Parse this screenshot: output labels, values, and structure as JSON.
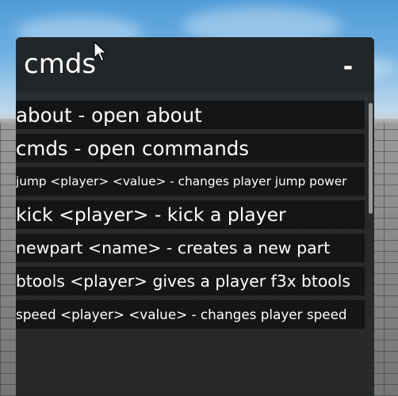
{
  "window": {
    "title": "cmds",
    "minimize_label": "-"
  },
  "commands": [
    {
      "text": "about - open about"
    },
    {
      "text": "cmds - open commands"
    },
    {
      "text": "jump <player> <value> - changes player jump power"
    },
    {
      "text": "kick <player> - kick a player"
    },
    {
      "text": "newpart <name> - creates a new part"
    },
    {
      "text": "btools <player> gives a player f3x btools"
    },
    {
      "text": "speed <player> <value> - changes player speed"
    }
  ],
  "colors": {
    "panel": "#202224",
    "row": "#141516",
    "text": "#ffffff",
    "scrollbar_thumb": "#9a9a9a",
    "sky": "#5fa7df",
    "ground": "#7d7d7d"
  },
  "icons": {
    "cursor": "arrow-cursor-icon"
  }
}
